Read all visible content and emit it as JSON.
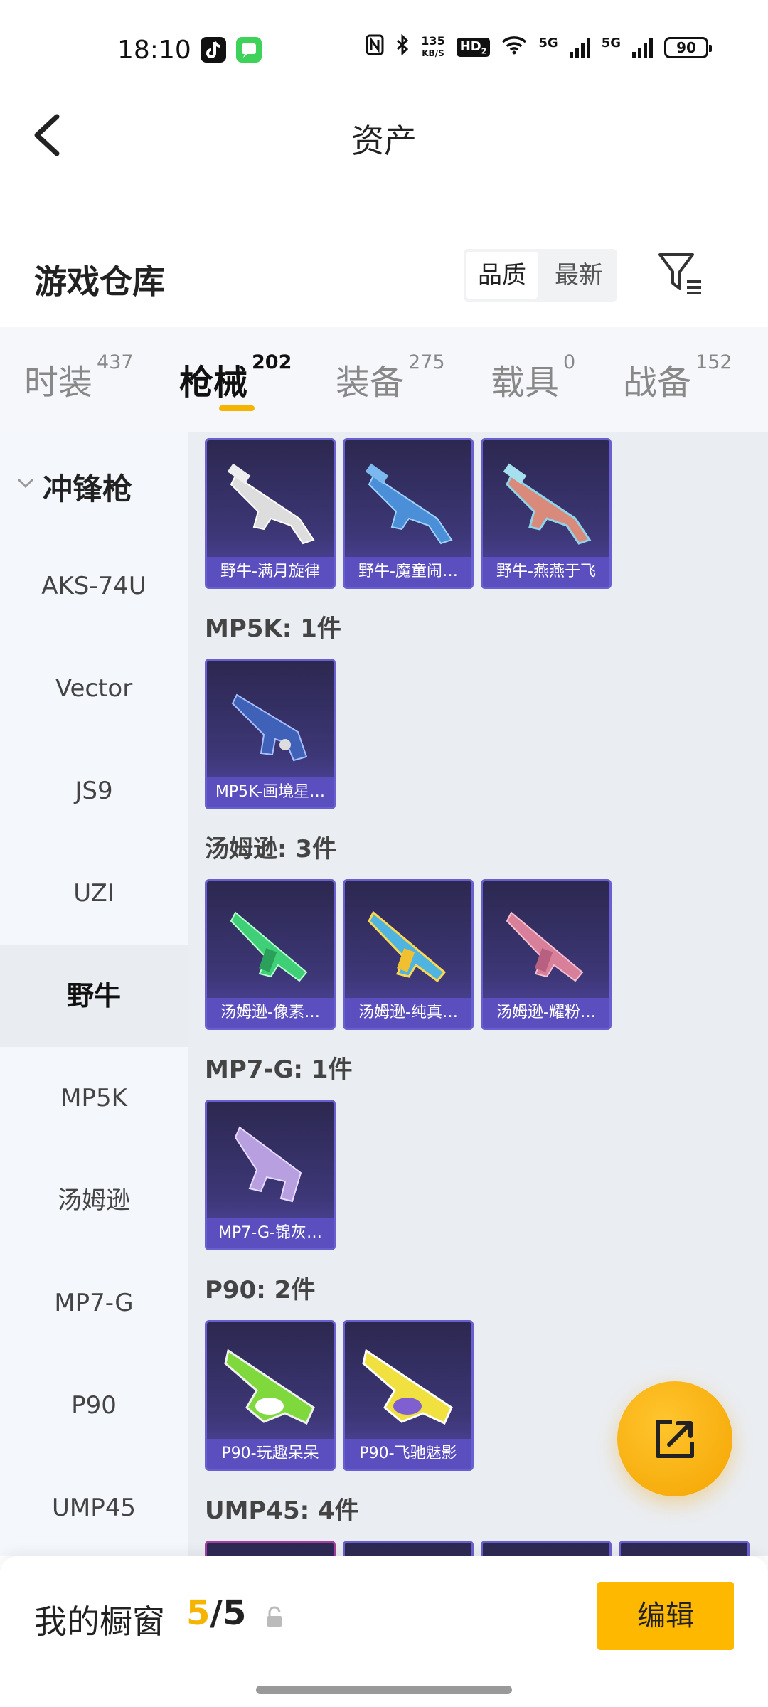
{
  "status_bar": {
    "time": "18:10",
    "net_speed_value": "135",
    "net_speed_unit": "KB/S",
    "hd_label": "HD",
    "hd_sub": "2",
    "sim1": "5G",
    "sim2": "5G",
    "battery": "90",
    "icons": [
      "tiktok-icon",
      "message-app-icon",
      "nfc-icon",
      "bluetooth-icon",
      "wifi-icon",
      "signal-icon"
    ]
  },
  "header": {
    "title": "资产",
    "back_icon": "back-arrow-icon"
  },
  "warehouse": {
    "title": "游戏仓库",
    "sort_options": [
      "品质",
      "最新"
    ],
    "sort_selected": "品质",
    "filter_icon": "filter-icon"
  },
  "tabs": [
    {
      "label": "时装",
      "count": "437"
    },
    {
      "label": "枪械",
      "count": "202",
      "active": true
    },
    {
      "label": "装备",
      "count": "275"
    },
    {
      "label": "载具",
      "count": "0"
    },
    {
      "label": "战备",
      "count": "152"
    }
  ],
  "sidebar": {
    "header": "冲锋枪",
    "items": [
      "AKS-74U",
      "Vector",
      "JS9",
      "UZI",
      "野牛",
      "MP5K",
      "汤姆逊",
      "MP7-G",
      "P90",
      "UMP45"
    ],
    "active": "野牛"
  },
  "groups": [
    {
      "label": "",
      "items": [
        "野牛-满月旋律",
        "野牛-魔童闹…",
        "野牛-燕燕于飞"
      ]
    },
    {
      "label": "MP5K: 1件",
      "items": [
        "MP5K-画境星…"
      ]
    },
    {
      "label": "汤姆逊: 3件",
      "items": [
        "汤姆逊-像素…",
        "汤姆逊-纯真…",
        "汤姆逊-耀粉…"
      ]
    },
    {
      "label": "MP7-G: 1件",
      "items": [
        "MP7-G-锦灰…"
      ]
    },
    {
      "label": "P90: 2件",
      "items": [
        "P90-玩趣呆呆",
        "P90-飞驰魅影"
      ]
    },
    {
      "label": "UMP45: 4件",
      "items": []
    }
  ],
  "colors": {
    "accent": "#f4b400",
    "card_bg": "#3d3777",
    "card_label": "#5b4fc0"
  },
  "fab": {
    "icon": "share-icon"
  },
  "bottom": {
    "label": "我的橱窗",
    "count_current": "5",
    "count_sep": "/",
    "count_total": "5",
    "lock_icon": "lock-icon",
    "edit_label": "编辑"
  }
}
